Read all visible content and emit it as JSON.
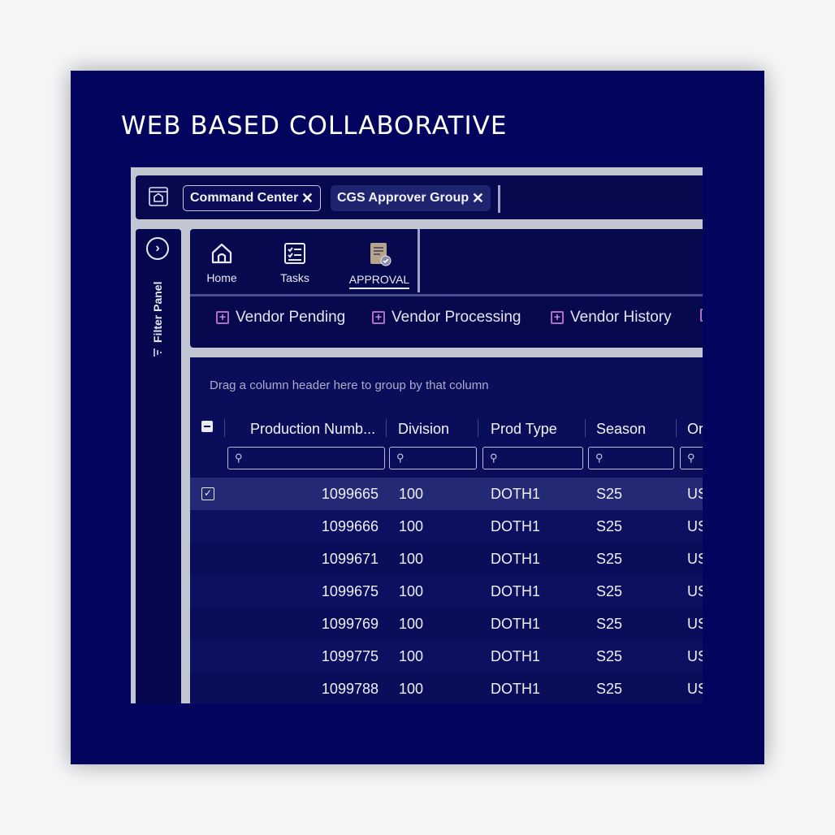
{
  "hero": {
    "title": "WEB BASED COLLABORATIVE"
  },
  "tabs": [
    {
      "label": "Command Center",
      "close": "✕"
    },
    {
      "label": "CGS Approver Group",
      "close": "✕"
    }
  ],
  "filter_panel": {
    "label": "Filter Panel",
    "toggle": "›"
  },
  "ribbon": {
    "buttons": [
      {
        "label": "Home",
        "icon": "home-icon"
      },
      {
        "label": "Tasks",
        "icon": "tasks-icon"
      },
      {
        "label": "APPROVAL",
        "icon": "approval-icon",
        "active": true
      }
    ],
    "sub_tabs": [
      {
        "label": "Vendor Pending"
      },
      {
        "label": "Vendor Processing"
      },
      {
        "label": "Vendor History"
      },
      {
        "label": ""
      }
    ]
  },
  "grid": {
    "group_hint": "Drag a column header here to group by that column",
    "columns": [
      "Production Numb...",
      "Division",
      "Prod Type",
      "Season",
      "Or"
    ],
    "rows": [
      {
        "production": "1099665",
        "division": "100",
        "prod_type": "DOTH1",
        "season": "S25",
        "origin": "US",
        "selected": true
      },
      {
        "production": "1099666",
        "division": "100",
        "prod_type": "DOTH1",
        "season": "S25",
        "origin": "US"
      },
      {
        "production": "1099671",
        "division": "100",
        "prod_type": "DOTH1",
        "season": "S25",
        "origin": "US"
      },
      {
        "production": "1099675",
        "division": "100",
        "prod_type": "DOTH1",
        "season": "S25",
        "origin": "US"
      },
      {
        "production": "1099769",
        "division": "100",
        "prod_type": "DOTH1",
        "season": "S25",
        "origin": "US"
      },
      {
        "production": "1099775",
        "division": "100",
        "prod_type": "DOTH1",
        "season": "S25",
        "origin": "US"
      },
      {
        "production": "1099788",
        "division": "100",
        "prod_type": "DOTH1",
        "season": "S25",
        "origin": "US"
      }
    ]
  },
  "colors": {
    "card": "#03045e",
    "panel": "#07094f",
    "accent": "#b06cc6"
  }
}
